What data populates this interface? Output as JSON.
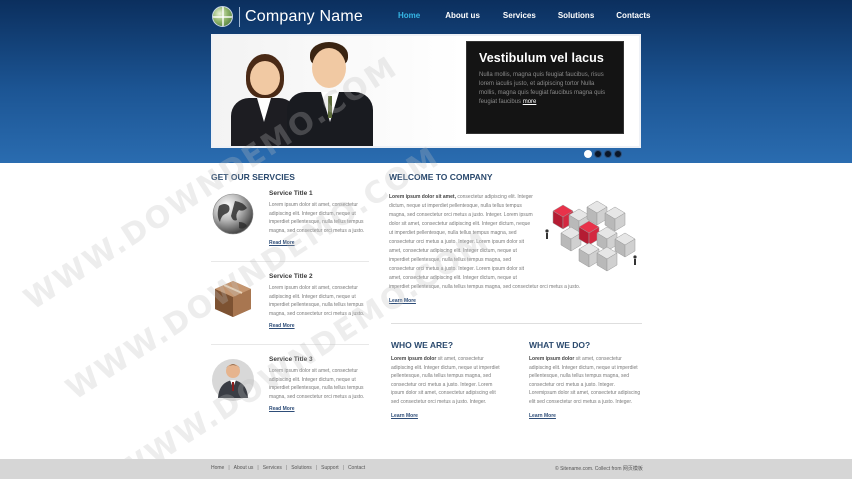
{
  "header": {
    "logo_text": "Company Name",
    "logo_icon": "globe-icon",
    "nav": [
      {
        "label": "Home",
        "active": true
      },
      {
        "label": "About us",
        "active": false
      },
      {
        "label": "Services",
        "active": false
      },
      {
        "label": "Solutions",
        "active": false
      },
      {
        "label": "Contacts",
        "active": false
      }
    ]
  },
  "slider": {
    "title": "Vestibulum vel lacus",
    "text": "Nulla mollis, magna quis feugiat faucibus, risus lorem iaculis justo, et adipiscing tortor Nulla mollis, magna quis feugiat faucibus magna quis feugiat faucibus",
    "more_label": "more",
    "active_slide": 1,
    "slide_count": 4
  },
  "services": {
    "heading": "GET OUR SERVCIES",
    "items": [
      {
        "title": "Service Title 1",
        "icon": "globe-icon",
        "text": "Lorem ipsum dolor sit amet, consectetur adipiscing elit. Integer dictum, neque ut imperdiet pellentesque, nulla tellus tempus magna, sed consectetur orci metus a justo.",
        "more": "Read More"
      },
      {
        "title": "Service Title 2",
        "icon": "box-icon",
        "text": "Lorem ipsum dolor sit amet, consectetur adipiscing elit. Integer dictum, neque ut imperdiet pellentesque, nulla tellus tempus magna, sed consectetur orci metus a justo.",
        "more": "Read More"
      },
      {
        "title": "Service Title 3",
        "icon": "businessman-icon",
        "text": "Lorem ipsum dolor sit amet, consectetur adipiscing elit. Integer dictum, neque ut imperdiet pellentesque, nulla tellus tempus magna, sed consectetur orci metus a justo.",
        "more": "Read More"
      }
    ]
  },
  "welcome": {
    "heading": "WELCOME TO COMPANY",
    "lead": "Lorem ipsum dolor sit amet,",
    "text": " consectetur adipiscing elit. Integer dictum, neque ut imperdiet pellentesque, nulla tellus tempus magna, sed consectetur orci metus a justo. Integer. Lorem ipsum dolor sit amet, consectetur adipiscing elit. Integer dictum, neque ut imperdiet pellentesque, nulla tellus tempus magna, sed consectetur orci metus a justo. Integer. Lorem ipsum dolor sit amet, consectetur adipiscing elit. Integer dictum, neque ut imperdiet pellentesque, nulla tellus tempus magna, sed consectetur orci metus a justo. Integer. Lorem ipsum dolor sit amet, consectetur adipiscing elit. Integer dictum, neque ut imperdiet pellentesque, nulla tellus tempus magna, sed consectetur orci metus a justo.",
    "more": "Learn More",
    "image_icon": "cubes-network-icon"
  },
  "who": {
    "heading": "WHO WE ARE?",
    "lead": "Lorem ipsum dolor",
    "text": " sit amet, consectetur adipiscing elit. Integer dictum, neque ut imperdiet pellentesque, nulla tellus tempus magna, sed consectetur orci metus a justo. Integer. Lorem ipsum dolor sit amet, consectetur adipiscing elit sed consectetur orci metus a justo. Integer.",
    "more": "Learn More"
  },
  "what": {
    "heading": "WHAT WE DO?",
    "lead": "Lorem ipsum dolor",
    "text": " sit amet, consectetur adipiscing elit. Integer dictum, neque ut imperdiet pellentesque, nulla tellus tempus magna, sed consectetur orci metus a justo. Integer. Loremipsum dolor sit amet, consectetur adipiscing elit sed consectetur orci metus a justo. Integer.",
    "more": "Learn More"
  },
  "footer": {
    "links": [
      "Home",
      "About us",
      "Services",
      "Solutions",
      "Support",
      "Contact"
    ],
    "copyright": "© Sitename.com. Collect from 网页模板"
  },
  "watermark": {
    "text": "WWW.DOWNDEMO.COM"
  },
  "colors": {
    "header_dark": "#0b2f5e",
    "header_light": "#2a6cb0",
    "nav_active": "#36b7e6",
    "heading": "#2b4a6e",
    "link": "#2e4d78",
    "footer": "#d6d6d6"
  }
}
